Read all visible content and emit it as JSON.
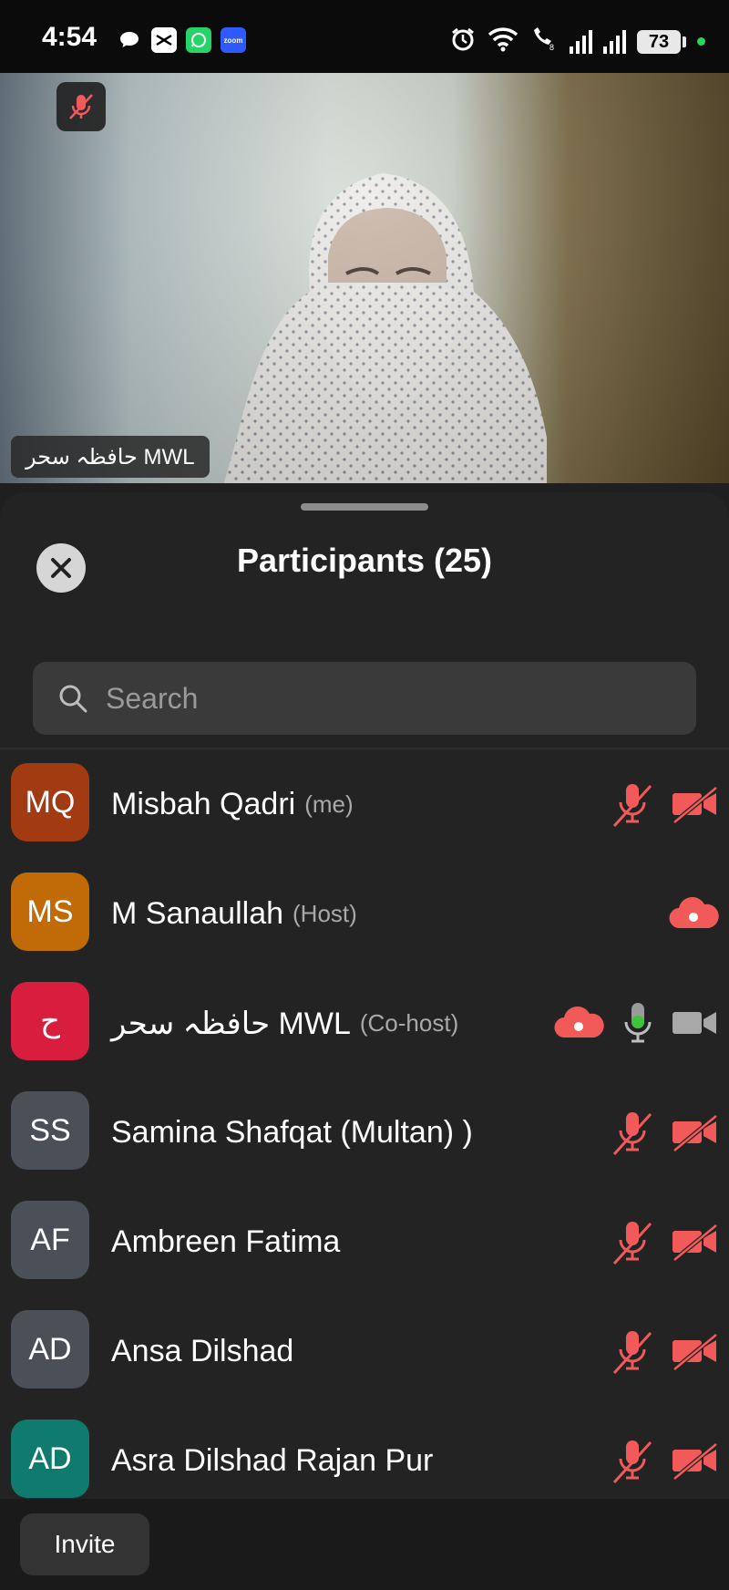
{
  "status_bar": {
    "time": "4:54",
    "battery": "73",
    "notification_icons": [
      "chat-bubble-icon",
      "capcut-icon",
      "whatsapp-icon",
      "zoom-icon"
    ],
    "right_icons": [
      "alarm-icon",
      "wifi-icon",
      "wifi-call-icon",
      "signal-icon",
      "signal-icon",
      "battery-icon",
      "active-dot-icon"
    ]
  },
  "video": {
    "speaker_name": "حافظہ سحر MWL",
    "mic_muted": true
  },
  "sheet": {
    "title": "Participants (25)",
    "search_placeholder": "Search",
    "invite_label": "Invite"
  },
  "participants": [
    {
      "initials": "MQ",
      "name": "Misbah Qadri",
      "role": "(me)",
      "avatar_color": "#a23a12",
      "mic": "muted",
      "video": "off",
      "recording": false
    },
    {
      "initials": "MS",
      "name": "M Sanaullah",
      "role": "(Host)",
      "avatar_color": "#c06a08",
      "mic": "none",
      "video": "none",
      "recording": true
    },
    {
      "initials": "ح",
      "name": "حافظہ سحر MWL",
      "role": "(Co-host)",
      "avatar_color": "#d81d3f",
      "mic": "active",
      "video": "on",
      "recording": true
    },
    {
      "initials": "SS",
      "name": "Samina Shafqat (Multan) )",
      "role": "",
      "avatar_color": "#4a4f58",
      "mic": "muted",
      "video": "off",
      "recording": false
    },
    {
      "initials": "AF",
      "name": "Ambreen Fatima",
      "role": "",
      "avatar_color": "#4a4f58",
      "mic": "muted",
      "video": "off",
      "recording": false
    },
    {
      "initials": "AD",
      "name": "Ansa Dilshad",
      "role": "",
      "avatar_color": "#4a4f58",
      "mic": "muted",
      "video": "off",
      "recording": false
    },
    {
      "initials": "AD",
      "name": "Asra Dilshad Rajan Pur",
      "role": "",
      "avatar_color": "#0f7b6f",
      "mic": "muted",
      "video": "off",
      "recording": false
    }
  ],
  "colors": {
    "muted_red": "#f25a5a",
    "mic_green": "#3ec43c",
    "icon_gray": "#bdbdbd"
  }
}
